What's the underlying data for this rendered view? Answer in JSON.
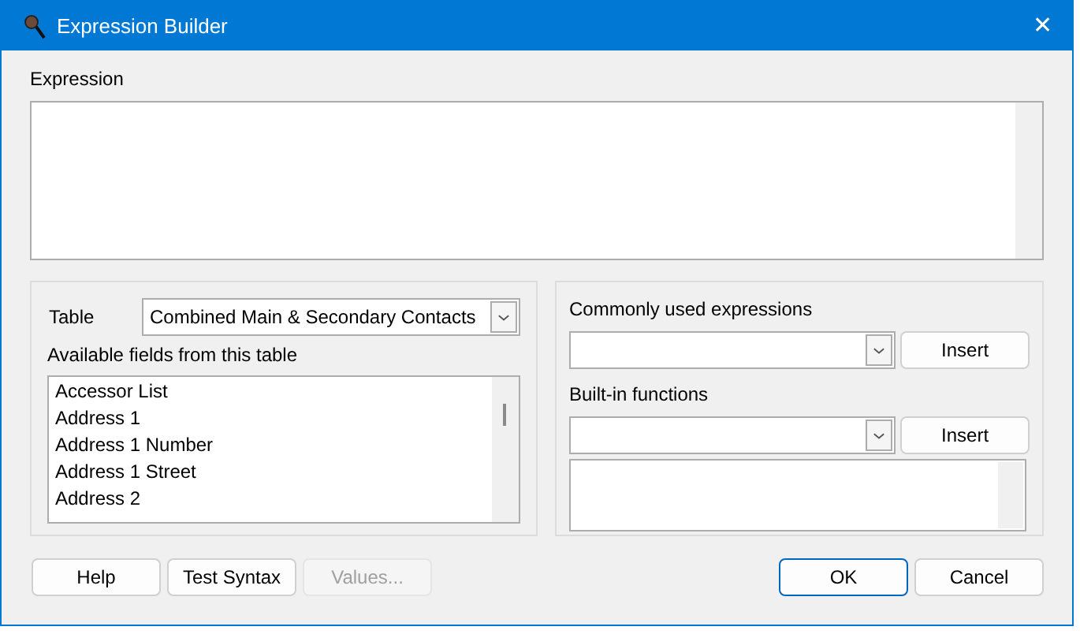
{
  "window": {
    "title": "Expression Builder",
    "close": "✕"
  },
  "expression": {
    "label": "Expression"
  },
  "table_picker": {
    "label": "Table",
    "value": "Combined Main & Secondary Contacts"
  },
  "fields": {
    "label": "Available fields from this table",
    "items": [
      {
        "text": "Accessor List"
      },
      {
        "text": "Address 1"
      },
      {
        "text": "Address 1 Number"
      },
      {
        "text": "Address 1 Street"
      },
      {
        "text": "Address 2"
      }
    ]
  },
  "common_expressions": {
    "label": "Commonly used expressions",
    "button": "Insert"
  },
  "builtin_functions": {
    "label": "Built-in functions",
    "button": "Insert"
  },
  "buttons": [
    {
      "label": "Help",
      "disabled": false,
      "default": false
    },
    {
      "label": "Test Syntax",
      "disabled": false,
      "default": false
    },
    {
      "label": "Values...",
      "disabled": true,
      "default": false
    },
    {
      "label": "OK",
      "disabled": false,
      "default": true
    },
    {
      "label": "Cancel",
      "disabled": false,
      "default": false
    }
  ]
}
